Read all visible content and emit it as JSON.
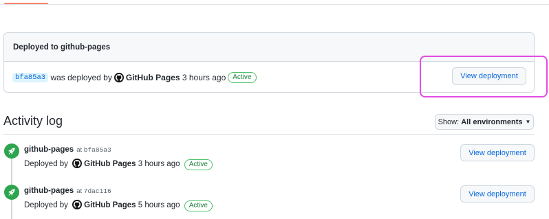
{
  "environment": {
    "header": "Deployed to github-pages",
    "sha": "bfa85a3",
    "deployed_by_text": "was deployed by",
    "deployer": "GitHub Pages",
    "time": "3 hours ago",
    "status": "Active",
    "button_label": "View deployment"
  },
  "activity": {
    "title": "Activity log",
    "filter_prefix": "Show:",
    "filter_value": "All environments",
    "events": [
      {
        "environment": "github-pages",
        "at_text": "at",
        "sha": "bfa85a3",
        "deployed_by_text": "Deployed by",
        "deployer": "GitHub Pages",
        "time": "3 hours ago",
        "status": "Active",
        "button_label": "View deployment"
      },
      {
        "environment": "github-pages",
        "at_text": "at",
        "sha": "7dac116",
        "deployed_by_text": "Deployed by",
        "deployer": "GitHub Pages",
        "time": "5 hours ago",
        "status": "Active",
        "button_label": "View deployment"
      }
    ]
  },
  "colors": {
    "link": "#0969da",
    "success": "#2da44e",
    "highlight": "#e34be3",
    "tab_accent": "#f9826c"
  },
  "icons": [
    "github-avatar-icon",
    "rocket-icon",
    "caret-down-icon"
  ]
}
